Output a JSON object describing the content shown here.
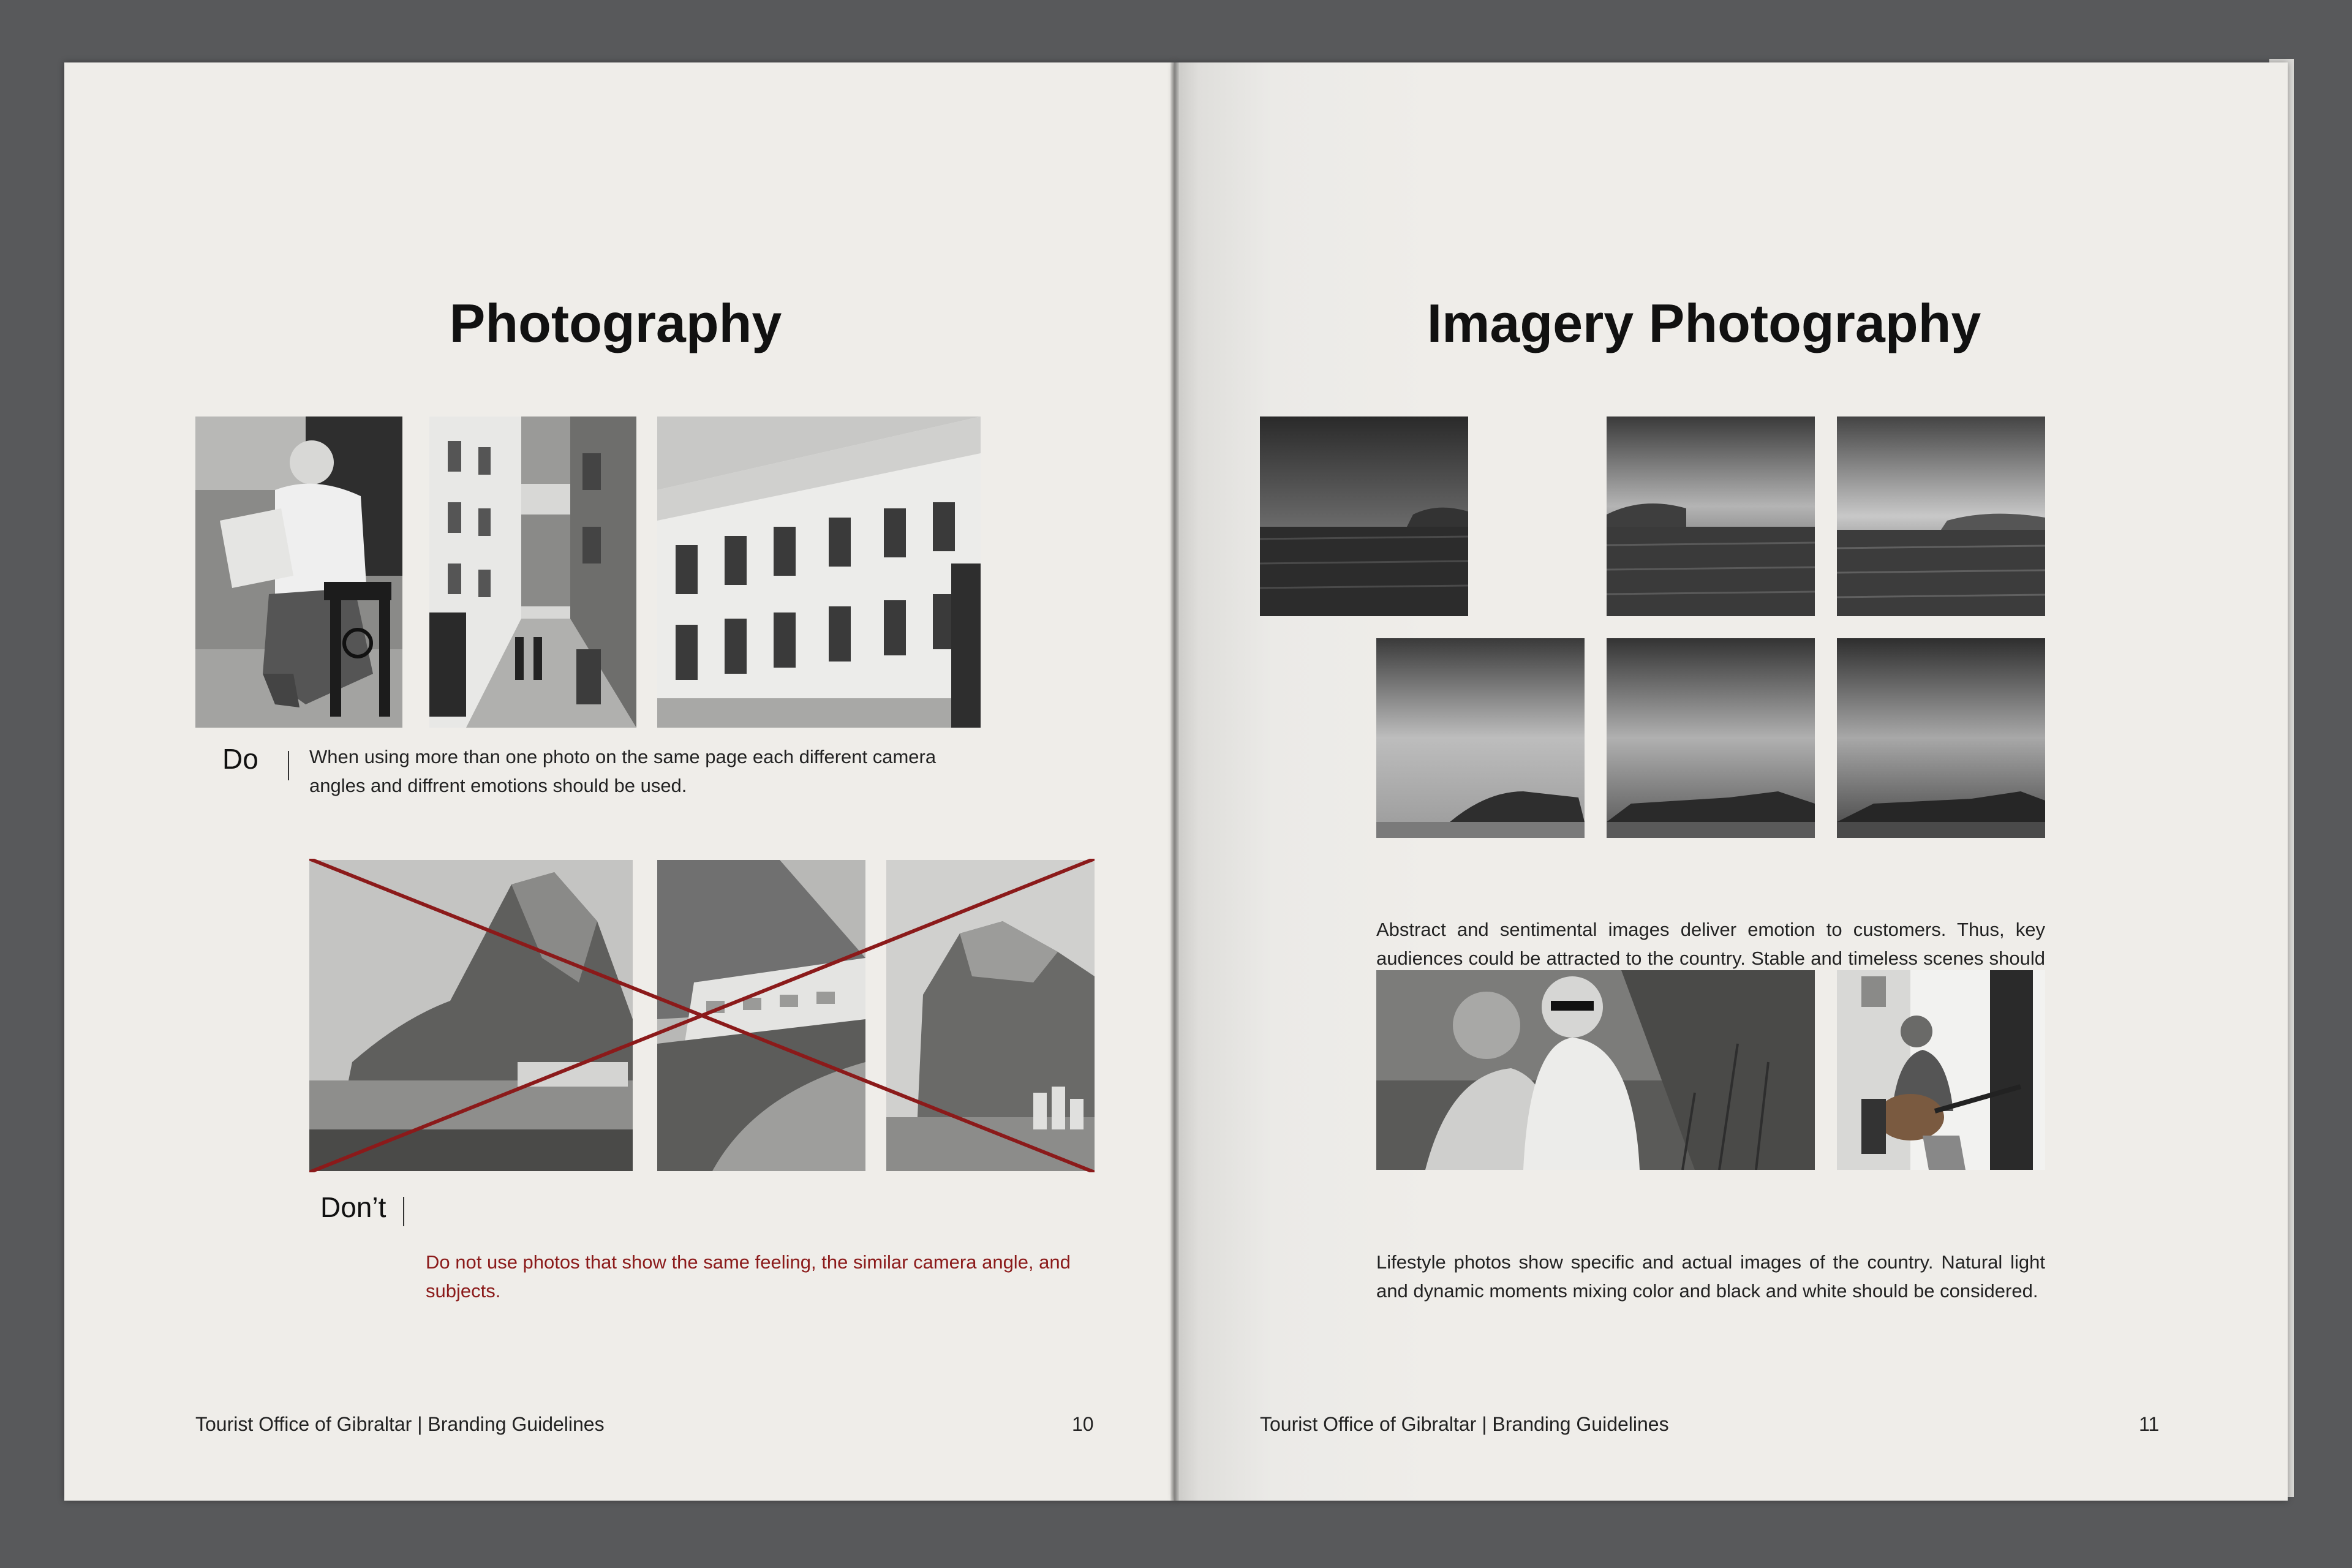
{
  "left_page": {
    "title": "Photography",
    "do": {
      "label": "Do",
      "text": "When using more than one photo on the same page each different camera angles and diffrent emotions should be used."
    },
    "dont": {
      "label": "Don’t",
      "text": "Do not use photos that show the same feeling, the similar camera angle, and subjects."
    },
    "footer": "Tourist Office of Gibraltar | Branding Guidelines",
    "page_number": "10"
  },
  "right_page": {
    "title": "Imagery Photography",
    "abstract_text": "Abstract and sentimental images deliver emotion to customers. Thus, key audiences could be attracted to the country. Stable and timeless scenes should be used.",
    "lifestyle_text": "Lifestyle photos show specific and actual images of the country. Natural light and dynamic moments mixing color and black and white should be considered.",
    "footer": "Tourist Office of Gibraltar | Branding Guidelines",
    "page_number": "11"
  },
  "colors": {
    "background": "#58595b",
    "page": "#efede9",
    "dont_red": "#8b1a1a"
  }
}
